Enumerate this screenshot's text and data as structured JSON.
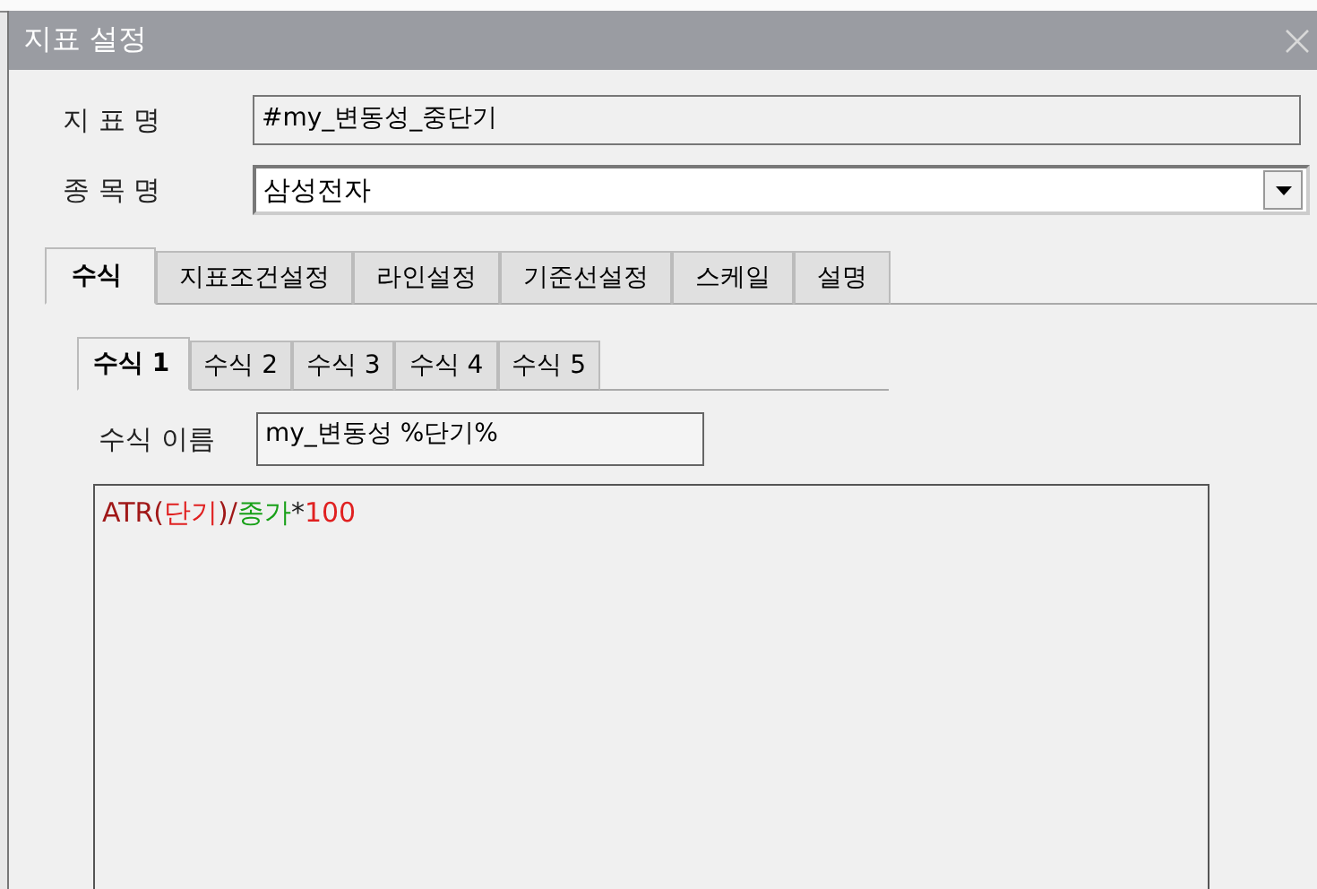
{
  "window": {
    "title": "지표 설정"
  },
  "fields": [
    {
      "kind": "text",
      "label": "지 표 명",
      "value": "#my_변동성_중단기"
    },
    {
      "kind": "combo",
      "label": "종 목 명",
      "value": "삼성전자"
    }
  ],
  "tabs": [
    {
      "label": "수식",
      "selected": true
    },
    {
      "label": "지표조건설정",
      "selected": false
    },
    {
      "label": "라인설정",
      "selected": false
    },
    {
      "label": "기준선설정",
      "selected": false
    },
    {
      "label": "스케일",
      "selected": false
    },
    {
      "label": "설명",
      "selected": false
    }
  ],
  "formula_tabs": [
    {
      "label": "수식 1",
      "selected": true
    },
    {
      "label": "수식 2",
      "selected": false
    },
    {
      "label": "수식 3",
      "selected": false
    },
    {
      "label": "수식 4",
      "selected": false
    },
    {
      "label": "수식 5",
      "selected": false
    }
  ],
  "formula_name": {
    "label": "수식 이름",
    "value": "my_변동성 %단기%"
  },
  "formula": [
    {
      "text": "ATR(",
      "color": "#a01818"
    },
    {
      "text": "단기",
      "color": "#e02020"
    },
    {
      "text": ")/",
      "color": "#a01818"
    },
    {
      "text": "종가",
      "color": "#18a018"
    },
    {
      "text": "*",
      "color": "#202020"
    },
    {
      "text": "100",
      "color": "#e02020"
    }
  ]
}
